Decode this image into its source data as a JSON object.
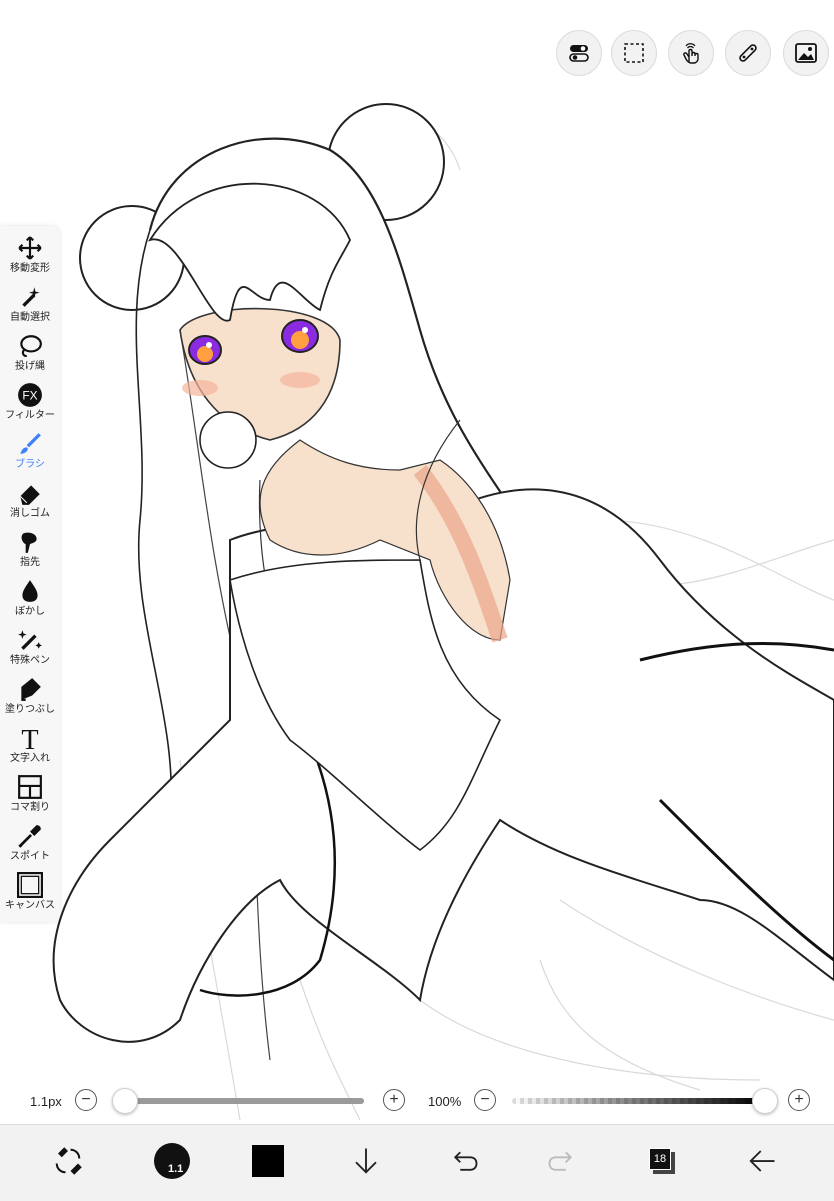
{
  "app": {
    "name": "Drawing app"
  },
  "top_toolbar": [
    {
      "name": "toggle-icon"
    },
    {
      "name": "selection-icon"
    },
    {
      "name": "touch-gesture-icon"
    },
    {
      "name": "ruler-icon"
    },
    {
      "name": "image-icon"
    }
  ],
  "tools": [
    {
      "label": "移動変形",
      "icon": "move-icon"
    },
    {
      "label": "自動選択",
      "icon": "magic-wand-icon"
    },
    {
      "label": "投げ縄",
      "icon": "lasso-icon"
    },
    {
      "label": "フィルター",
      "icon": "fx-icon",
      "icon_text": "FX"
    },
    {
      "label": "ブラシ",
      "icon": "brush-icon",
      "active": true
    },
    {
      "label": "消しゴム",
      "icon": "eraser-icon"
    },
    {
      "label": "指先",
      "icon": "smudge-icon"
    },
    {
      "label": "ぼかし",
      "icon": "blur-icon"
    },
    {
      "label": "特殊ペン",
      "icon": "special-pen-icon"
    },
    {
      "label": "塗りつぶし",
      "icon": "fill-icon"
    },
    {
      "label": "文字入れ",
      "icon": "text-icon",
      "icon_text": "T"
    },
    {
      "label": "コマ割り",
      "icon": "panel-icon"
    },
    {
      "label": "スポイト",
      "icon": "eyedropper-icon"
    },
    {
      "label": "キャンバス",
      "icon": "canvas-icon"
    }
  ],
  "brush_size": {
    "value_label": "1.1px",
    "minus": "−",
    "plus": "+",
    "level": 0.0
  },
  "opacity": {
    "value_label": "100%",
    "minus": "−",
    "plus": "+",
    "level": 1.0
  },
  "bottom_bar": {
    "brush_preview_text": "1.1",
    "color": "#000000",
    "layer_count": "18"
  },
  "colors": {
    "accent": "#3b82f6",
    "skin": "#f7e1cc",
    "shadow": "#e9a58a",
    "eye": "#8a2be2"
  }
}
